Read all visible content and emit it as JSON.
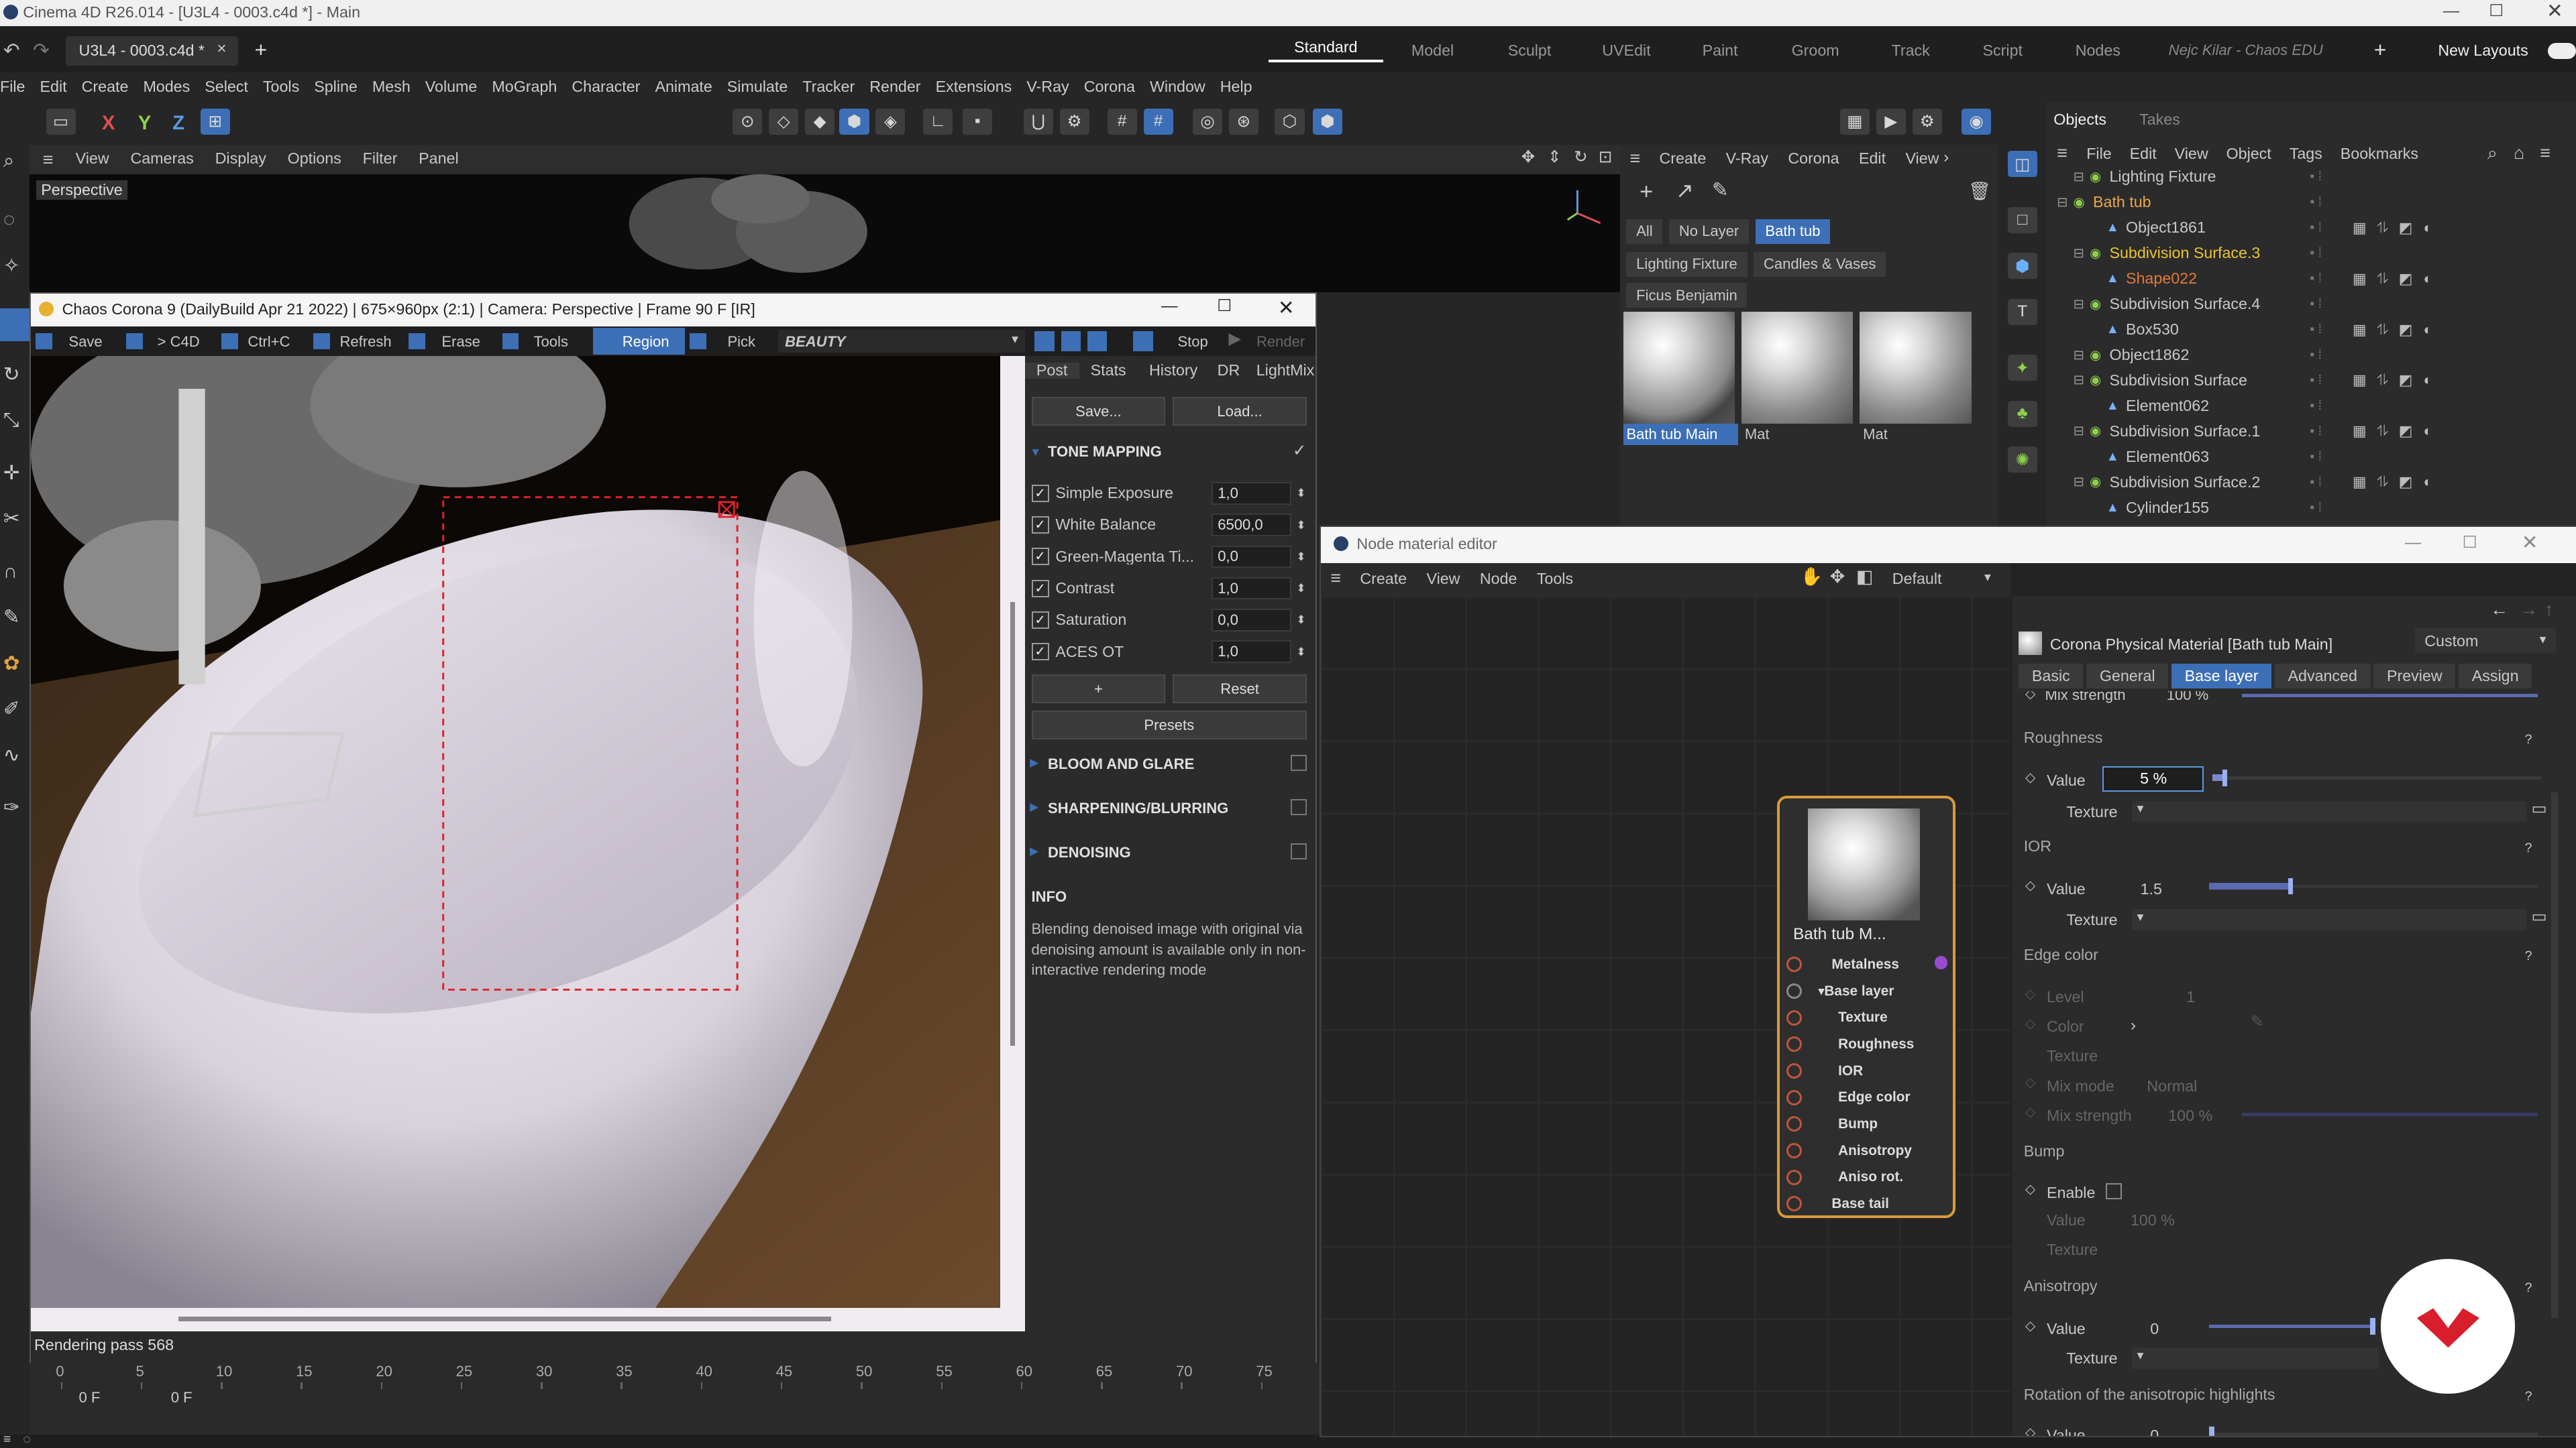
{
  "window": {
    "title": "Cinema 4D R26.014 - [U3L4 - 0003.c4d *] - Main"
  },
  "tab": {
    "label": "U3L4 - 0003.c4d *",
    "close": "×",
    "add": "+"
  },
  "layouts": [
    "Standard",
    "Model",
    "Sculpt",
    "UVEdit",
    "Paint",
    "Groom",
    "Track",
    "Script",
    "Nodes"
  ],
  "user": "Nejc Kilar - Chaos EDU",
  "new_layouts": "New Layouts",
  "menu": [
    "File",
    "Edit",
    "Create",
    "Modes",
    "Select",
    "Tools",
    "Spline",
    "Mesh",
    "Volume",
    "MoGraph",
    "Character",
    "Animate",
    "Simulate",
    "Tracker",
    "Render",
    "Extensions",
    "V-Ray",
    "Corona",
    "Window",
    "Help"
  ],
  "axes": {
    "x": "X",
    "y": "Y",
    "z": "Z"
  },
  "viewport": {
    "menu": [
      "View",
      "Cameras",
      "Display",
      "Options",
      "Filter",
      "Panel"
    ],
    "label": "Perspective"
  },
  "vfb": {
    "title": "Chaos Corona 9 (DailyBuild Apr 21 2022) | 675×960px (2:1) | Camera: Perspective | Frame 90 F [IR]",
    "toolbar": [
      "Save",
      "> C4D",
      "Ctrl+C",
      "Refresh",
      "Erase",
      "Tools",
      "Region",
      "Pick"
    ],
    "beauty": "BEAUTY",
    "stop": "Stop",
    "render": "Render",
    "tabs": [
      "Post",
      "Stats",
      "History",
      "DR",
      "LightMix"
    ],
    "save_btn": "Save...",
    "load_btn": "Load...",
    "tone_mapping": "TONE MAPPING",
    "params": [
      {
        "label": "Simple Exposure",
        "value": "1,0"
      },
      {
        "label": "White Balance",
        "value": "6500,0"
      },
      {
        "label": "Green-Magenta Ti...",
        "value": "0,0"
      },
      {
        "label": "Contrast",
        "value": "1,0"
      },
      {
        "label": "Saturation",
        "value": "0,0"
      },
      {
        "label": "ACES OT",
        "value": "1,0"
      }
    ],
    "plus": "+",
    "reset": "Reset",
    "presets": "Presets",
    "sections": [
      "BLOOM AND GLARE",
      "SHARPENING/BLURRING",
      "DENOISING"
    ],
    "info_title": "INFO",
    "info_text": "Blending denoised image with original via denoising amount is available only in non-interactive rendering mode",
    "status": "Rendering pass 568"
  },
  "materials": {
    "menu": [
      "Create",
      "V-Ray",
      "Corona",
      "Edit",
      "View"
    ],
    "filters": [
      "All",
      "No Layer",
      "Bath tub"
    ],
    "layers": [
      "Lighting Fixture",
      "Candles & Vases",
      "Ficus Benjamin"
    ],
    "items": [
      "Bath tub Main",
      "Mat",
      "Mat"
    ]
  },
  "objects": {
    "tabs": [
      "Objects",
      "Takes"
    ],
    "menu": [
      "File",
      "Edit",
      "View",
      "Object",
      "Tags",
      "Bookmarks"
    ],
    "rows": [
      {
        "name": "Lighting Fixture",
        "indent": 1
      },
      {
        "name": "Bath tub",
        "indent": 0,
        "color": "#e9a64a"
      },
      {
        "name": "Object1861",
        "indent": 2
      },
      {
        "name": "Subdivision Surface.3",
        "indent": 1,
        "color": "#e9c431"
      },
      {
        "name": "Shape022",
        "indent": 2,
        "color": "#e07a3a"
      },
      {
        "name": "Subdivision Surface.4",
        "indent": 1
      },
      {
        "name": "Box530",
        "indent": 2
      },
      {
        "name": "Object1862",
        "indent": 1
      },
      {
        "name": "Subdivision Surface",
        "indent": 1
      },
      {
        "name": "Element062",
        "indent": 2
      },
      {
        "name": "Subdivision Surface.1",
        "indent": 1
      },
      {
        "name": "Element063",
        "indent": 2
      },
      {
        "name": "Subdivision Surface.2",
        "indent": 1
      },
      {
        "name": "Cylinder155",
        "indent": 2
      }
    ]
  },
  "node_editor": {
    "title": "Node material editor",
    "menu": [
      "Create",
      "View",
      "Node",
      "Tools"
    ],
    "default": "Default",
    "node_title": "Bath tub M...",
    "ports": [
      "Metalness",
      "Base layer",
      "Texture",
      "Roughness",
      "IOR",
      "Edge color",
      "Bump",
      "Anisotropy",
      "Aniso rot.",
      "Base tail"
    ],
    "material_name": "Corona Physical Material [Bath tub Main]",
    "preset": "Custom",
    "attr_tabs": [
      "Basic",
      "General",
      "Base layer",
      "Advanced",
      "Preview",
      "Assign"
    ],
    "mix_strength": {
      "label": "Mix strength",
      "value": "100 %"
    },
    "roughness": {
      "title": "Roughness",
      "value": "5 %"
    },
    "ior": {
      "title": "IOR",
      "value": "1.5"
    },
    "edge_color": {
      "title": "Edge color",
      "level_label": "Level",
      "level": "1",
      "color_label": "Color",
      "texture_label": "Texture",
      "mix_mode_label": "Mix mode",
      "mix_mode": "Normal",
      "mix_strength_label": "Mix strength",
      "mix_strength": "100 %"
    },
    "bump": {
      "title": "Bump",
      "enable": "Enable",
      "value": "100 %"
    },
    "anisotropy": {
      "title": "Anisotropy",
      "value": "0"
    },
    "rotation": {
      "title": "Rotation of the anisotropic highlights",
      "value": "0"
    },
    "value_label": "Value",
    "texture_label": "Texture"
  },
  "timeline": {
    "ticks": [
      "0",
      "5",
      "10",
      "15",
      "20",
      "25",
      "30",
      "35",
      "40",
      "45",
      "50",
      "55",
      "60",
      "65",
      "70",
      "75"
    ],
    "start": "0 F",
    "current": "0 F"
  },
  "colors": {
    "accent": "#3d6fb6",
    "orange": "#e9a64a",
    "node_border": "#d99a3d",
    "region": "#e0202a"
  }
}
